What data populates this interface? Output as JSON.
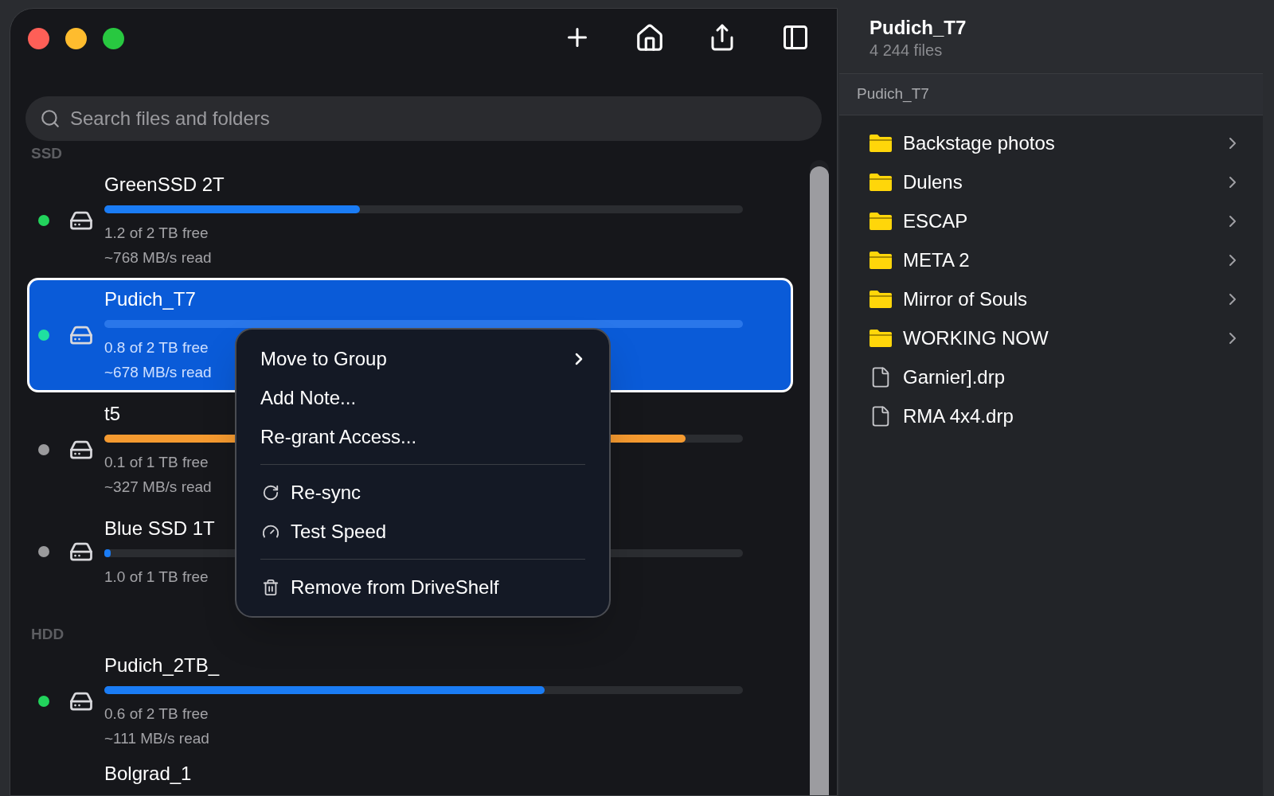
{
  "search": {
    "placeholder": "Search files and folders"
  },
  "groups": [
    {
      "label": "SSD",
      "drives": [
        {
          "name": "GreenSSD 2T",
          "level": 0.4,
          "low_space": false,
          "free": "1.2 of 2 TB free",
          "read": "~768 MB/s read",
          "color": "#22d35c",
          "selected": false
        },
        {
          "name": "Pudich_T7",
          "free": "0.8 of 2 TB free",
          "read": "~678 MB/s read",
          "color": "#1fe0a0",
          "selected": true
        },
        {
          "name": "t5",
          "level": 0.91,
          "low_space": true,
          "free": "0.1 of 1 TB free",
          "read": "~327 MB/s read",
          "color": "#9a9a9c",
          "selected": false
        },
        {
          "name": "Blue SSD 1T",
          "level": 0.01,
          "low_space": false,
          "free": "1.0 of 1 TB free",
          "color": "#9a9a9c",
          "selected": false
        }
      ]
    },
    {
      "label": "HDD",
      "drives": [
        {
          "name": "Pudich_2TB_",
          "level": 0.69,
          "low_space": false,
          "free": "0.6 of 2 TB free",
          "read": "~111 MB/s read",
          "color": "#22d35c",
          "selected": false
        },
        {
          "name": "Bolgrad_1",
          "selected": false
        }
      ]
    }
  ],
  "context_menu": {
    "sections": [
      [
        {
          "label": "Move to Group",
          "submenu": true
        },
        {
          "label": "Add Note...",
          "submenu": false
        },
        {
          "label": "Re-grant Access...",
          "submenu": false
        }
      ],
      [
        {
          "label": "Re-sync",
          "submenu": false
        },
        {
          "label": "Test Speed",
          "submenu": false
        }
      ],
      [
        {
          "label": "Remove from DriveShelf",
          "submenu": false
        }
      ]
    ]
  },
  "detail": {
    "title": "Pudich_T7",
    "subtitle": "4 244 files",
    "breadcrumb": "Pudich_T7",
    "items": [
      {
        "kind": "folder",
        "name": "Backstage photos"
      },
      {
        "kind": "folder",
        "name": "Dulens"
      },
      {
        "kind": "folder",
        "name": "ESCAP"
      },
      {
        "kind": "folder",
        "name": "META 2"
      },
      {
        "kind": "folder",
        "name": "Mirror of Souls"
      },
      {
        "kind": "folder",
        "name": "WORKING NOW"
      },
      {
        "kind": "file",
        "name": "Garnier].drp"
      },
      {
        "kind": "file",
        "name": "RMA 4x4.drp"
      }
    ]
  }
}
